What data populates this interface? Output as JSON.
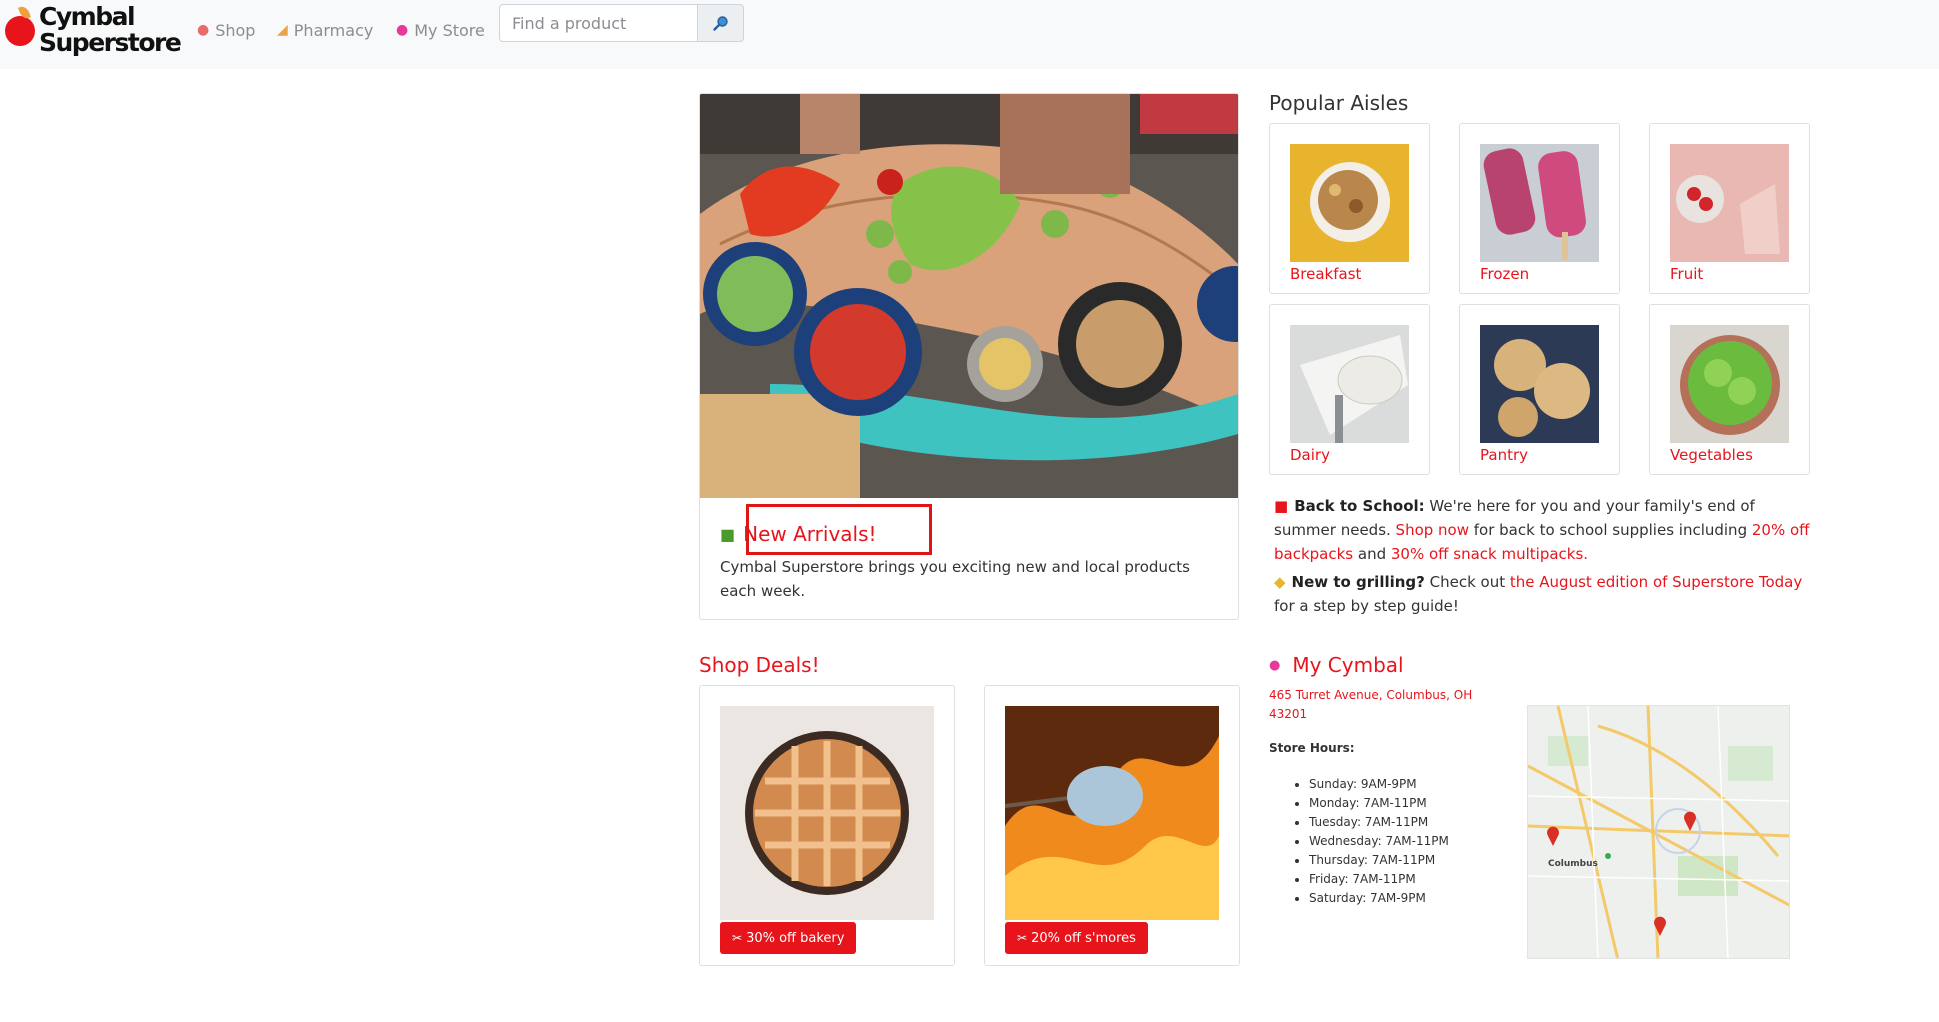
{
  "brand": {
    "line1": "Cymbal",
    "line2": "Superstore",
    "apple_color": "#e8141c"
  },
  "nav": [
    {
      "label": "Shop",
      "icon": "apple-icon"
    },
    {
      "label": "Pharmacy",
      "icon": "pill-icon"
    },
    {
      "label": "My Store",
      "icon": "map-pin-icon"
    }
  ],
  "search": {
    "placeholder": "Find a product",
    "value": "",
    "button_icon": "magnifier-icon"
  },
  "hero": {
    "title": "New Arrivals!",
    "icon": "gift-icon",
    "text": "Cymbal Superstore brings you exciting new and local products each week."
  },
  "aisles": {
    "title": "Popular Aisles",
    "items": [
      "Breakfast",
      "Frozen",
      "Fruit",
      "Dairy",
      "Pantry",
      "Vegetables"
    ]
  },
  "announcements": {
    "school": {
      "bold": "Back to School:",
      "t1": " We're here for you and your family's end of summer needs. ",
      "link1": "Shop now",
      "t2": " for back to school supplies including ",
      "link2": "20% off backpacks",
      "t3": " and ",
      "link3": "30% off snack multipacks."
    },
    "grill": {
      "bold": "New to grilling?",
      "t1": " Check out ",
      "link1": "the August edition of Superstore Today",
      "t2": " for a step by step guide!"
    }
  },
  "deals": {
    "title": "Shop Deals!",
    "items": [
      {
        "label": "30% off bakery"
      },
      {
        "label": "20% off s'mores"
      }
    ]
  },
  "my_cymbal": {
    "title": "My Cymbal",
    "address": "465 Turret Avenue, Columbus, OH 43201",
    "hours_label": "Store Hours:",
    "hours": [
      "Sunday: 9AM-9PM",
      "Monday: 7AM-11PM",
      "Tuesday: 7AM-11PM",
      "Wednesday: 7AM-11PM",
      "Thursday: 7AM-11PM",
      "Friday: 7AM-11PM",
      "Saturday: 7AM-9PM"
    ],
    "map_label": "Columbus"
  },
  "colors": {
    "accent": "#e8141c",
    "navbar_bg": "#f8f9fa",
    "border": "#dfdfdf"
  }
}
